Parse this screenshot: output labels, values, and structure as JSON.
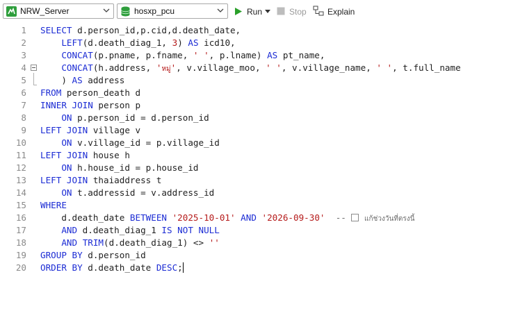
{
  "toolbar": {
    "connection": "NRW_Server",
    "database": "hosxp_pcu",
    "run_label": "Run",
    "stop_label": "Stop",
    "explain_label": "Explain"
  },
  "editor": {
    "line_numbers": [
      "1",
      "2",
      "3",
      "4",
      "5",
      "6",
      "7",
      "8",
      "9",
      "10",
      "11",
      "12",
      "13",
      "14",
      "15",
      "16",
      "17",
      "18",
      "19",
      "20"
    ],
    "thai_hint": "แก้ช่วงวันที่ตรงนี้"
  },
  "colors": {
    "keyword": "#1b2bd4",
    "string": "#b51a1a",
    "run_green": "#2aa02a"
  }
}
